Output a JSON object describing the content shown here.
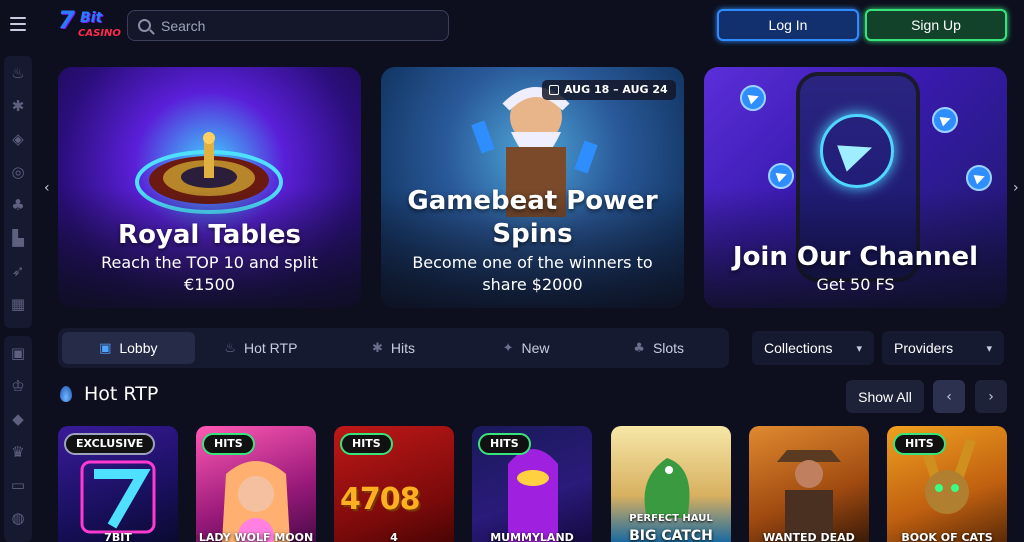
{
  "header": {
    "logo_number": "7",
    "logo_word": "Bit",
    "logo_casino": "CASINO",
    "search_placeholder": "Search",
    "login_label": "Log In",
    "signup_label": "Sign Up"
  },
  "sidebar": {
    "group1": [
      "flame-icon",
      "star-icon",
      "dice-icon",
      "target-icon",
      "clubs-icon",
      "hat-icon",
      "rocket-icon",
      "cards-icon"
    ],
    "group2": [
      "gift-icon",
      "trophy-icon",
      "vip-icon",
      "crown-icon",
      "wallet-icon",
      "chat-icon"
    ]
  },
  "banners": [
    {
      "title": "Royal Tables",
      "subtitle_1": "Reach the TOP 10 and split",
      "subtitle_2": "€1500"
    },
    {
      "title_1": "Gamebeat Power",
      "title_2": "Spins",
      "subtitle_1": "Become one of the winners to",
      "subtitle_2": "share $2000",
      "date": "AUG 18 – AUG 24"
    },
    {
      "title": "Join Our Channel",
      "subtitle": "Get 50 FS"
    }
  ],
  "tabs": [
    {
      "label": "Lobby",
      "icon": "lobby-icon",
      "active": true
    },
    {
      "label": "Hot RTP",
      "icon": "flame-icon",
      "active": false
    },
    {
      "label": "Hits",
      "icon": "star-icon",
      "active": false
    },
    {
      "label": "New",
      "icon": "new-icon",
      "active": false
    },
    {
      "label": "Slots",
      "icon": "cherry-icon",
      "active": false
    }
  ],
  "filters": {
    "collections_label": "Collections",
    "providers_label": "Providers"
  },
  "section": {
    "title": "Hot RTP",
    "show_all_label": "Show All"
  },
  "games": [
    {
      "badge": "EXCLUSIVE",
      "name": "7BIT"
    },
    {
      "badge": "HITS",
      "name": "LADY WOLF MOON"
    },
    {
      "badge": "HITS",
      "name": "4"
    },
    {
      "badge": "HITS",
      "name": "MUMMYLAND"
    },
    {
      "badge": "",
      "name": "BIG CATCH"
    },
    {
      "badge": "",
      "name": "WANTED DEAD"
    },
    {
      "badge": "HITS",
      "name": "BOOK OF CATS"
    }
  ],
  "game_tile_text": {
    "slot_digits": "4708",
    "perfect_haul": "PERFECT HAUL"
  },
  "colors": {
    "background": "#0d0f1e",
    "login_accent": "#2f8cff",
    "signup_accent": "#37e37a",
    "badge_hits": "#39e37b"
  }
}
